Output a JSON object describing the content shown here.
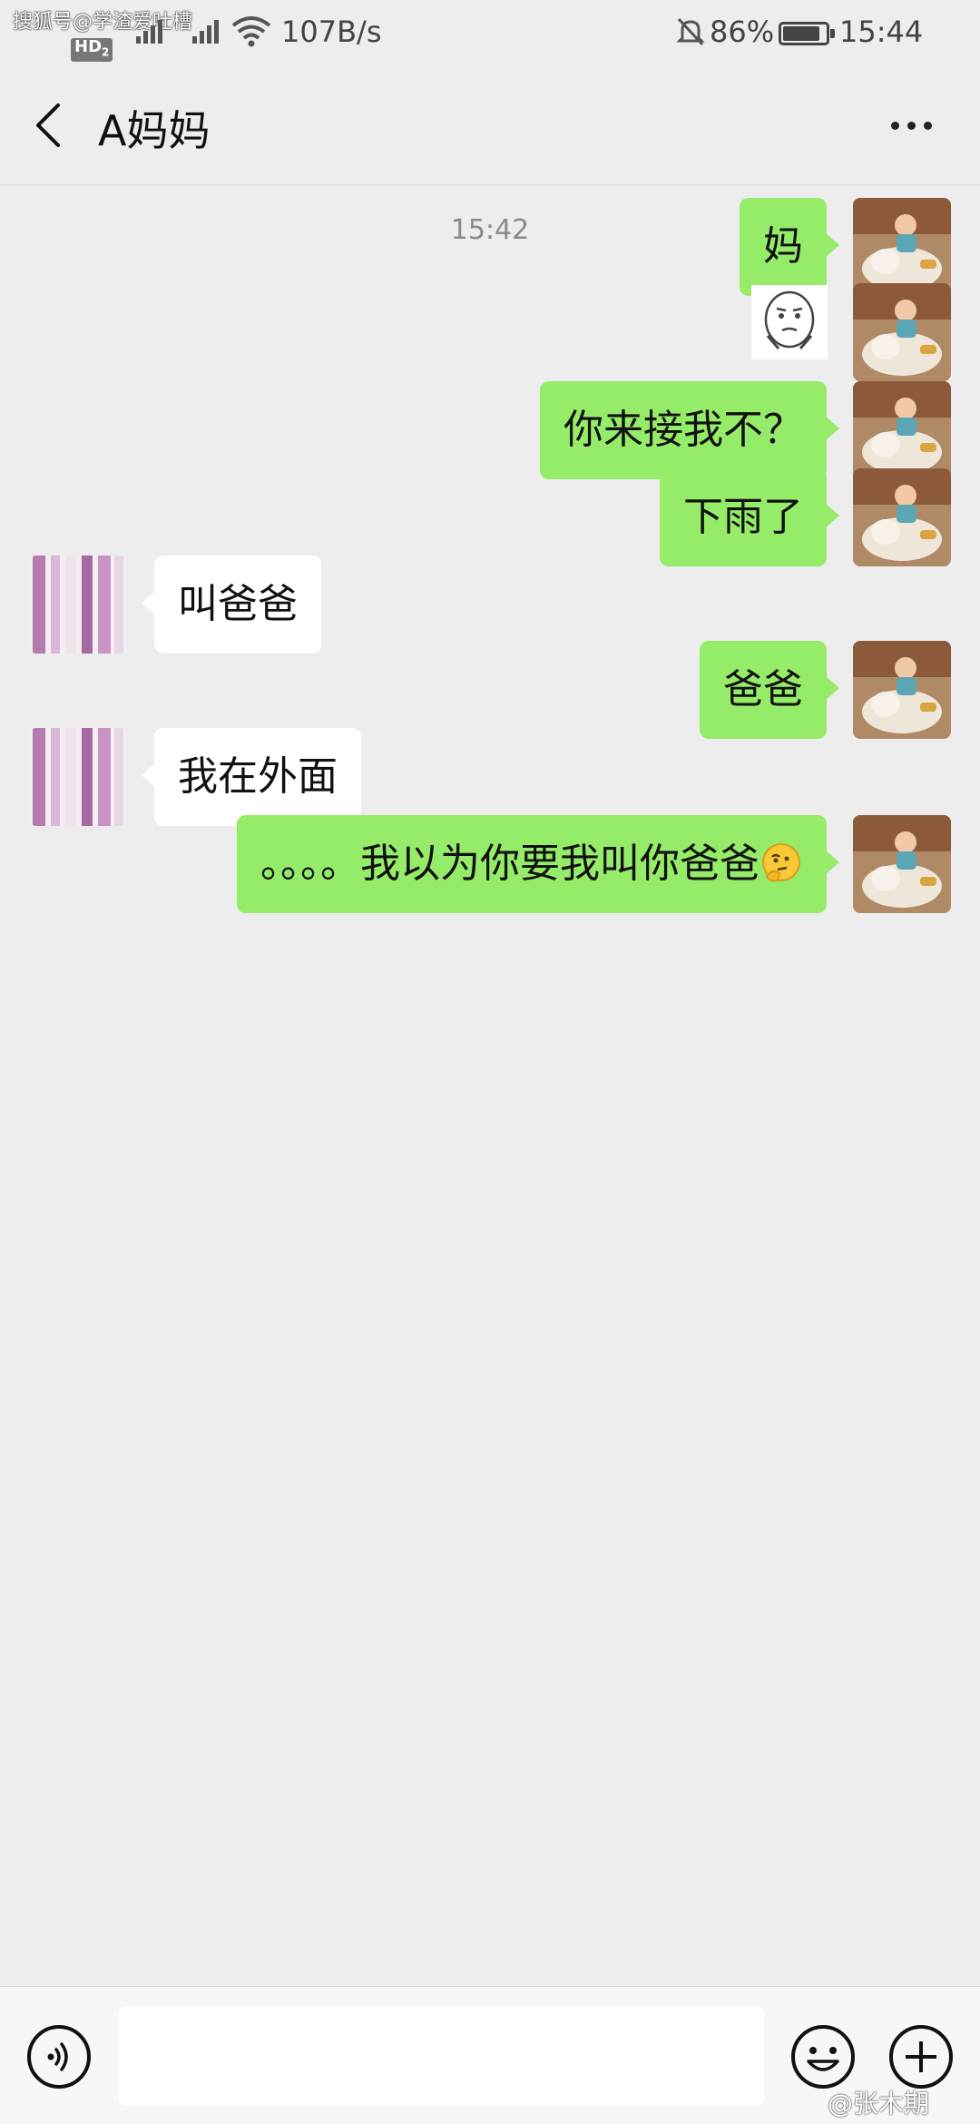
{
  "status_bar": {
    "watermark": "搜狐号@学渣爱吐槽",
    "hd_label": "HD",
    "hd_sub": "2",
    "network_speed": "107B/s",
    "battery_percent": "86%",
    "battery_level": 0.86,
    "time": "15:44"
  },
  "header": {
    "back_icon": "chevron-left-icon",
    "title": "A妈妈",
    "more_icon": "more-dots-icon"
  },
  "timestamp": "15:42",
  "messages": [
    {
      "sender": "me",
      "type": "text",
      "text": "妈"
    },
    {
      "sender": "me",
      "type": "sticker",
      "icon": "hand-on-face-meme-sticker"
    },
    {
      "sender": "me",
      "type": "text",
      "text": "你来接我不？"
    },
    {
      "sender": "me",
      "type": "text",
      "text": "下雨了"
    },
    {
      "sender": "other",
      "type": "text",
      "text": "叫爸爸"
    },
    {
      "sender": "me",
      "type": "text",
      "text": "爸爸"
    },
    {
      "sender": "other",
      "type": "text",
      "text": "我在外面"
    },
    {
      "sender": "me",
      "type": "text",
      "text": "。。。。我以为你要我叫你爸爸",
      "emoji": "thinking-face-emoji"
    }
  ],
  "input_bar": {
    "voice_icon": "voice-icon",
    "placeholder": "",
    "emoji_icon": "smiley-icon",
    "plus_icon": "plus-circle-icon"
  },
  "corner_watermark": "@张木期",
  "colors": {
    "background": "#ededed",
    "my_bubble": "#95ec69",
    "other_bubble": "#ffffff"
  }
}
